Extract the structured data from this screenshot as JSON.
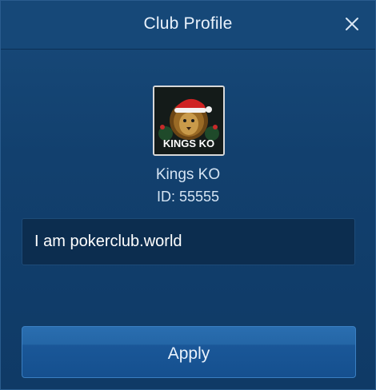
{
  "dialog": {
    "title": "Club Profile",
    "close_icon": "close-icon"
  },
  "club": {
    "logo_icon": "club-logo-lion-santa-hat",
    "logo_text": "KINGS KO",
    "name": "Kings KO",
    "id_text": "ID: 55555"
  },
  "description": {
    "text": "I am pokerclub.world"
  },
  "actions": {
    "apply_label": "Apply"
  },
  "colors": {
    "background": "#12406e",
    "header": "#164878",
    "accent_button": "#1f5fa0",
    "text": "#d5e4f3"
  }
}
